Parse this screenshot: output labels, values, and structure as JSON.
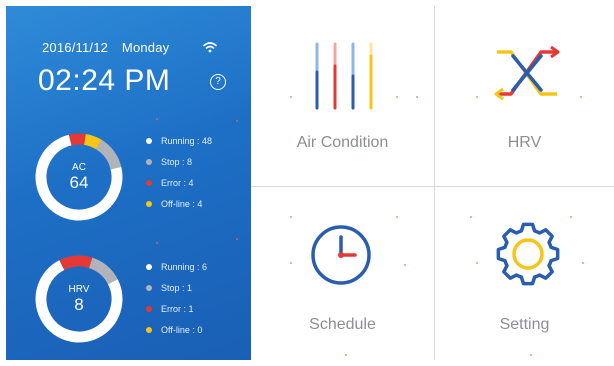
{
  "status": {
    "date": "2016/11/12",
    "weekday": "Monday",
    "time": "02:24 PM",
    "wifi_icon": "wifi-icon",
    "help_icon_glyph": "?"
  },
  "devices": [
    {
      "name": "AC",
      "total": "64",
      "legend": [
        {
          "label": "Running : 48",
          "color": "#ffffff",
          "value": 48
        },
        {
          "label": "Stop : 8",
          "color": "#b0b3b8",
          "value": 8
        },
        {
          "label": "Error : 4",
          "color": "#e53935",
          "value": 4
        },
        {
          "label": "Off-line : 4",
          "color": "#f5c518",
          "value": 4
        }
      ]
    },
    {
      "name": "HRV",
      "total": "8",
      "legend": [
        {
          "label": "Running : 6",
          "color": "#ffffff",
          "value": 6
        },
        {
          "label": "Stop : 1",
          "color": "#b0b3b8",
          "value": 1
        },
        {
          "label": "Error : 1",
          "color": "#e53935",
          "value": 1
        },
        {
          "label": "Off-line : 0",
          "color": "#f5c518",
          "value": 0
        }
      ]
    }
  ],
  "tiles": [
    {
      "label": "Air Condition",
      "icon": "air-condition-icon"
    },
    {
      "label": "HRV",
      "icon": "hrv-icon"
    },
    {
      "label": "Schedule",
      "icon": "clock-icon"
    },
    {
      "label": "Setting",
      "icon": "gear-icon"
    }
  ],
  "colors": {
    "panel_blue": "#1d6fc6",
    "accent_red": "#e53935",
    "accent_yellow": "#f5c518",
    "accent_blue": "#2a5db0",
    "light_blue": "#8fb6e8",
    "tile_text": "#8b8f94"
  }
}
